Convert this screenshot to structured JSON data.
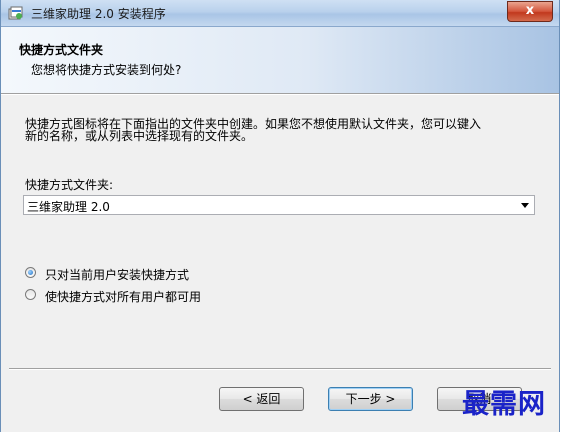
{
  "window": {
    "title": "三维家助理 2.0 安装程序",
    "close_glyph": "x"
  },
  "header": {
    "title": "快捷方式文件夹",
    "subtitle": "您想将快捷方式安装到何处?"
  },
  "body": {
    "description_line1": "快捷方式图标将在下面指出的文件夹中创建。如果您不想使用默认文件夹，您可以键入",
    "description_line2": "新的名称，或从列表中选择现有的文件夹。",
    "folder_label": "快捷方式文件夹:",
    "folder_value": "三维家助理 2.0",
    "radio_options": [
      {
        "label": "只对当前用户安装快捷方式",
        "selected": true
      },
      {
        "label": "使快捷方式对所有用户都可用",
        "selected": false
      }
    ]
  },
  "footer": {
    "back_label": "< 返回",
    "next_label": "下一步 >",
    "cancel_label": "取消"
  },
  "watermark": {
    "text": "最需网"
  },
  "colors": {
    "watermark": "#1a23c8",
    "close_button": "#c1381d",
    "default_button_border": "#3c7fb1"
  }
}
